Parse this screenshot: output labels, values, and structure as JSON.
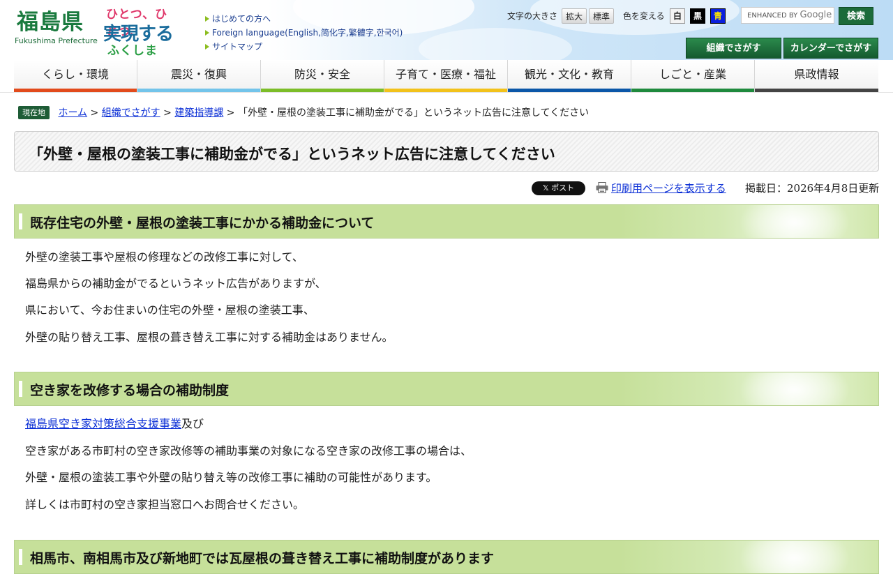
{
  "header": {
    "logo_kanji": "福島県",
    "logo_roman": "Fukushima Prefecture",
    "slogan": {
      "line1": "ひとつ、ひとつ、",
      "line2": "実現する",
      "line3": "ふくしま"
    },
    "links": [
      "はじめての方へ",
      "Foreign language(English,简化字,繁體字,한국어)",
      "サイトマップ"
    ],
    "font_size_label": "文字の大きさ",
    "font_enlarge": "拡大",
    "font_standard": "標準",
    "color_label": "色を変える",
    "color_white": "白",
    "color_black": "黒",
    "color_blue": "青",
    "search_prefix": "ENHANCED BY",
    "search_brand": "Google",
    "search_button": "検索",
    "org_search": "組織でさがす",
    "calendar_search": "カレンダーでさがす"
  },
  "nav": [
    {
      "label": "くらし・環境",
      "color": "#e24b1c"
    },
    {
      "label": "震災・復興",
      "color": "#73c4ea"
    },
    {
      "label": "防災・安全",
      "color": "#7cbd28"
    },
    {
      "label": "子育て・医療・福祉",
      "color": "#f2c21b"
    },
    {
      "label": "観光・文化・教育",
      "color": "#0b57a8"
    },
    {
      "label": "しごと・産業",
      "color": "#1f8a3d"
    },
    {
      "label": "県政情報",
      "color": "#444444"
    }
  ],
  "breadcrumb": {
    "badge": "現在地",
    "home": "ホーム",
    "sep": " > ",
    "org": "組織でさがす",
    "dept": "建築指導課",
    "current": "「外壁・屋根の塗装工事に補助金がでる」というネット広告に注意してください"
  },
  "title": "「外壁・屋根の塗装工事に補助金がでる」というネット広告に注意してください",
  "meta": {
    "xpost": "𝕏 ポスト",
    "print": "印刷用ページを表示する",
    "updated": "掲載日：2026年4月8日更新"
  },
  "sections": [
    {
      "heading": "既存住宅の外壁・屋根の塗装工事にかかる補助金について",
      "paragraphs": [
        "外壁の塗装工事や屋根の修理などの改修工事に対して、",
        "福島県からの補助金がでるというネット広告がありますが、",
        "県において、今お住まいの住宅の外壁・屋根の塗装工事、",
        "外壁の貼り替え工事、屋根の葺き替え工事に対する補助金はありません。"
      ]
    },
    {
      "heading": "空き家を改修する場合の補助制度",
      "link": "福島県空き家対策総合支援事業",
      "link_suffix": "及び",
      "paragraphs": [
        "空き家がある市町村の空き家改修等の補助事業の対象になる空き家の改修工事の場合は、",
        "外壁・屋根の塗装工事や外壁の貼り替え等の改修工事に補助の可能性があります。",
        "詳しくは市町村の空き家担当窓口へお問合せください。"
      ]
    },
    {
      "heading": "相馬市、南相馬市及び新地町では瓦屋根の葺き替え工事に補助制度があります"
    }
  ]
}
